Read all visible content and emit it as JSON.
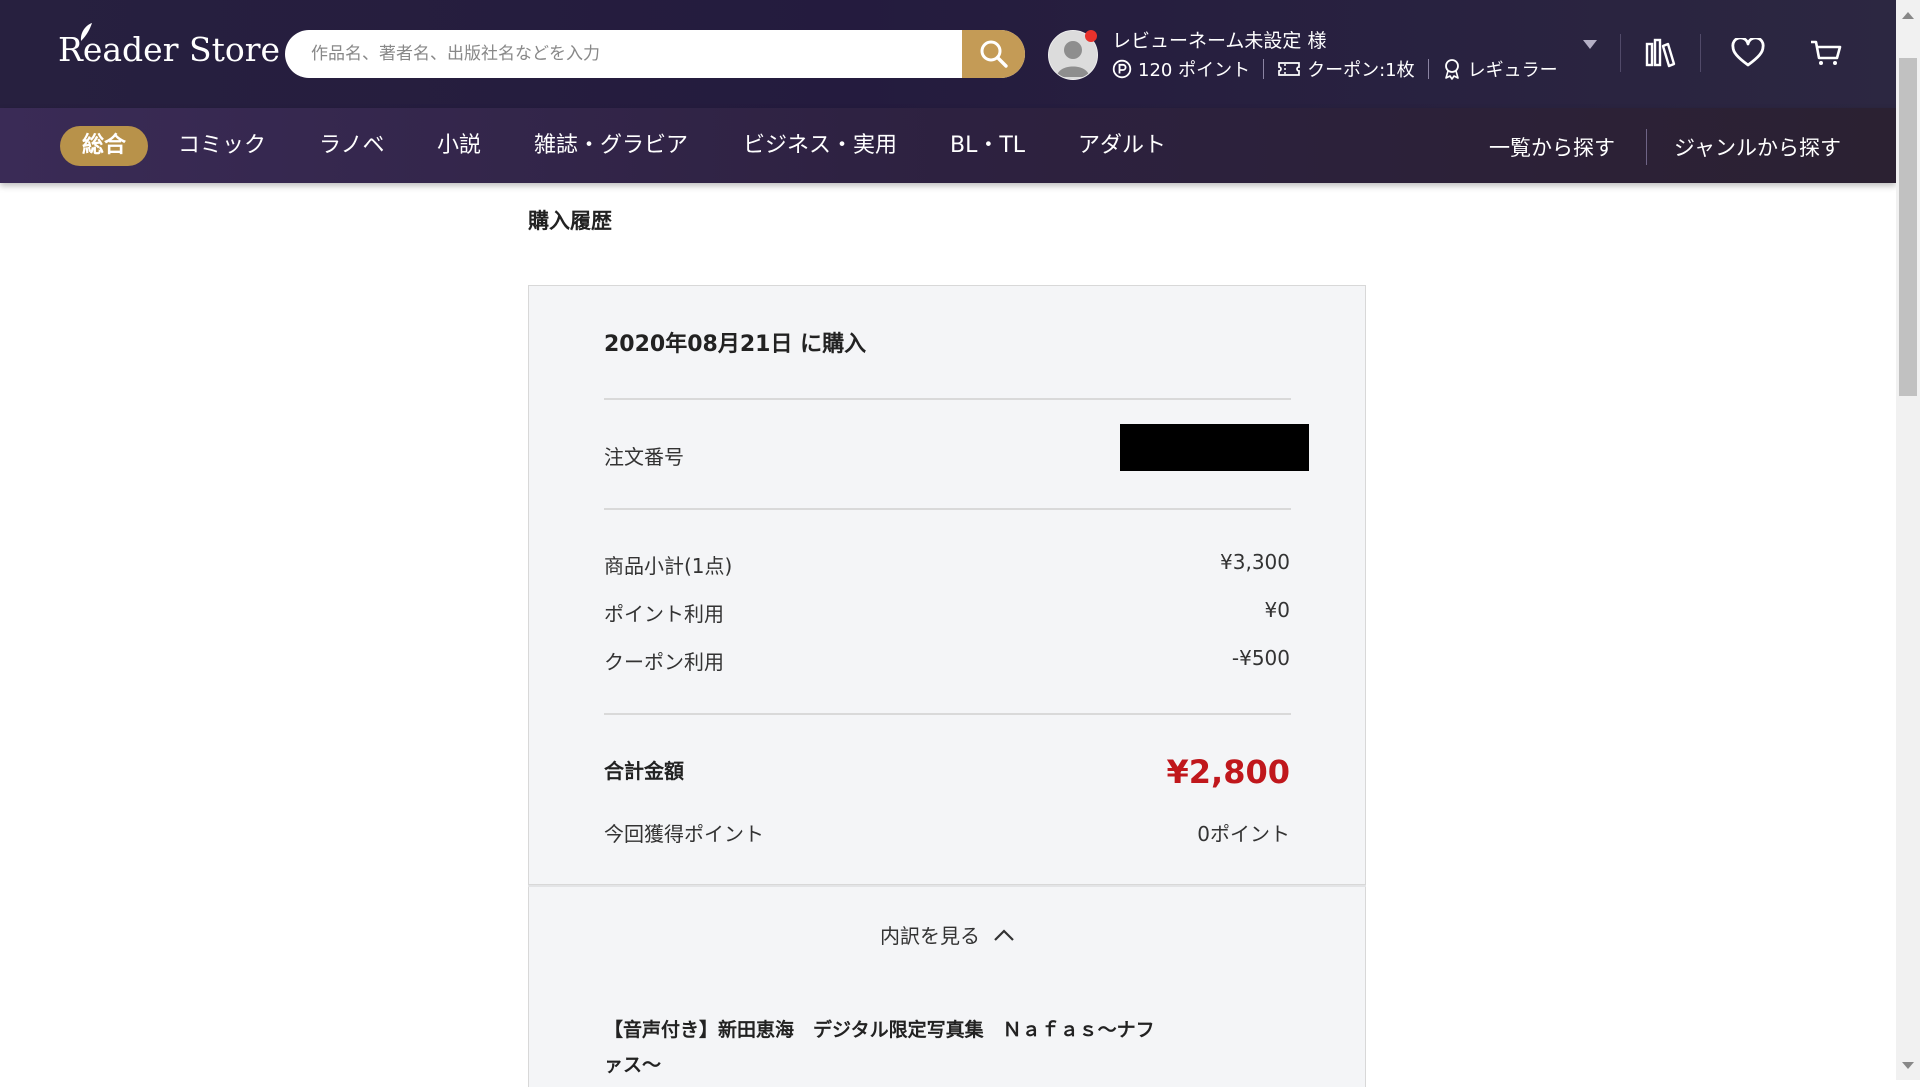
{
  "header": {
    "logo_text": "Reader Store",
    "search_placeholder": "作品名、著者名、出版社名などを入力",
    "user_name": "レビューネーム未設定 様",
    "points": "120 ポイント",
    "coupons": "クーポン:1枚",
    "rank": "レギュラー"
  },
  "nav": {
    "items": [
      "総合",
      "コミック",
      "ラノベ",
      "小説",
      "雑誌・グラビア",
      "ビジネス・実用",
      "BL・TL",
      "アダルト"
    ],
    "active": "総合",
    "right": [
      "一覧から探す",
      "ジャンルから探す"
    ]
  },
  "page": {
    "title": "購入履歴"
  },
  "order": {
    "date_text": "2020年08月21日 に購入",
    "order_number_label": "注文番号",
    "subtotal_label": "商品小計(1点)",
    "subtotal_value": "¥3,300",
    "points_used_label": "ポイント利用",
    "points_used_value": "¥0",
    "coupon_used_label": "クーポン利用",
    "coupon_used_value": "-¥500",
    "total_label": "合計金額",
    "total_value": "¥2,800",
    "earned_points_label": "今回獲得ポイント",
    "earned_points_value": "0ポイント",
    "details_toggle": "内訳を見る",
    "item_title": "【音声付き】新田恵海　デジタル限定写真集　Ｎａｆａｓ～ナファス～"
  },
  "colors": {
    "accent_gold": "#b8924a",
    "total_red": "#c0171c",
    "header_bg": "#27203f"
  }
}
